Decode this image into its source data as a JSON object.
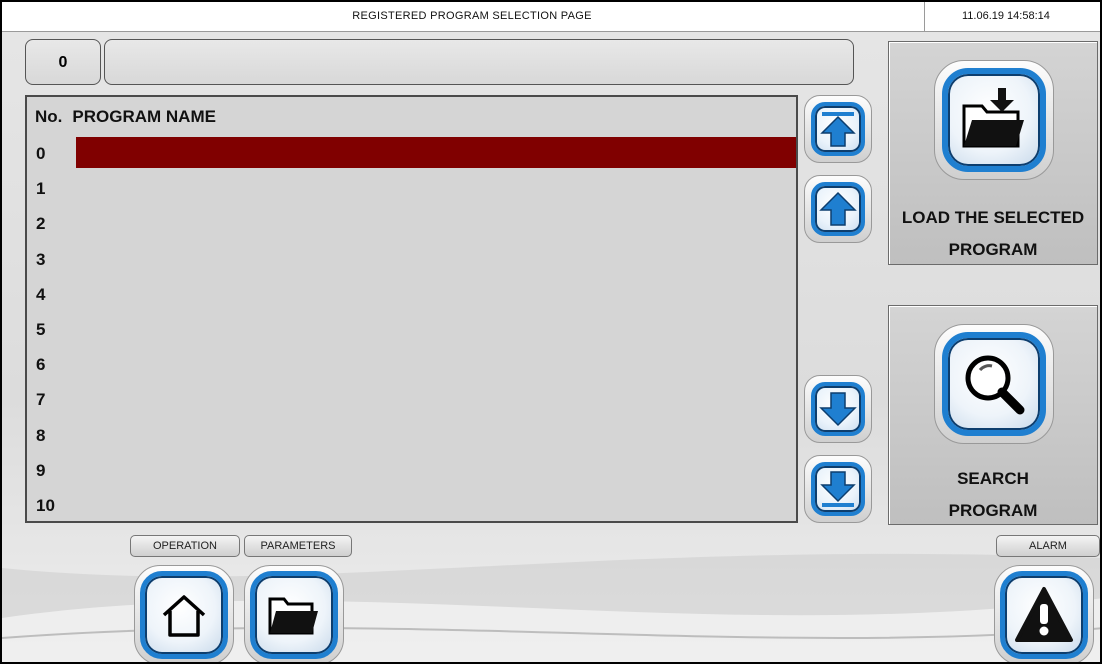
{
  "header": {
    "title": "REGISTERED PROGRAM SELECTION PAGE",
    "datetime": "11.06.19   14:58:14"
  },
  "selection": {
    "number": "0",
    "name": ""
  },
  "program_list": {
    "columns": [
      "No.",
      "PROGRAM NAME"
    ],
    "rows": [
      {
        "no": "0",
        "name": ""
      },
      {
        "no": "1",
        "name": ""
      },
      {
        "no": "2",
        "name": ""
      },
      {
        "no": "3",
        "name": ""
      },
      {
        "no": "4",
        "name": ""
      },
      {
        "no": "5",
        "name": ""
      },
      {
        "no": "6",
        "name": ""
      },
      {
        "no": "7",
        "name": ""
      },
      {
        "no": "8",
        "name": ""
      },
      {
        "no": "9",
        "name": ""
      },
      {
        "no": "10",
        "name": ""
      }
    ],
    "selected_row": 0,
    "selected_color": "#800000"
  },
  "scroll_buttons": [
    {
      "icon": "arrow-up-to-top-icon"
    },
    {
      "icon": "arrow-up-icon"
    },
    {
      "icon": "arrow-down-icon"
    },
    {
      "icon": "arrow-down-to-bottom-icon"
    }
  ],
  "actions": {
    "load_label_line1": "LOAD THE SELECTED",
    "load_label_line2": "PROGRAM",
    "load_icon": "folder-load-icon",
    "search_label_line1": "SEARCH",
    "search_label_line2": "PROGRAM",
    "search_icon": "magnifier-icon"
  },
  "nav": {
    "operation_label": "OPERATION",
    "parameters_label": "PARAMETERS",
    "alarm_label": "ALARM"
  },
  "colors": {
    "accent": "#1f7fd0",
    "accent_dark": "#0d3e6e",
    "selected_row": "#800000"
  }
}
